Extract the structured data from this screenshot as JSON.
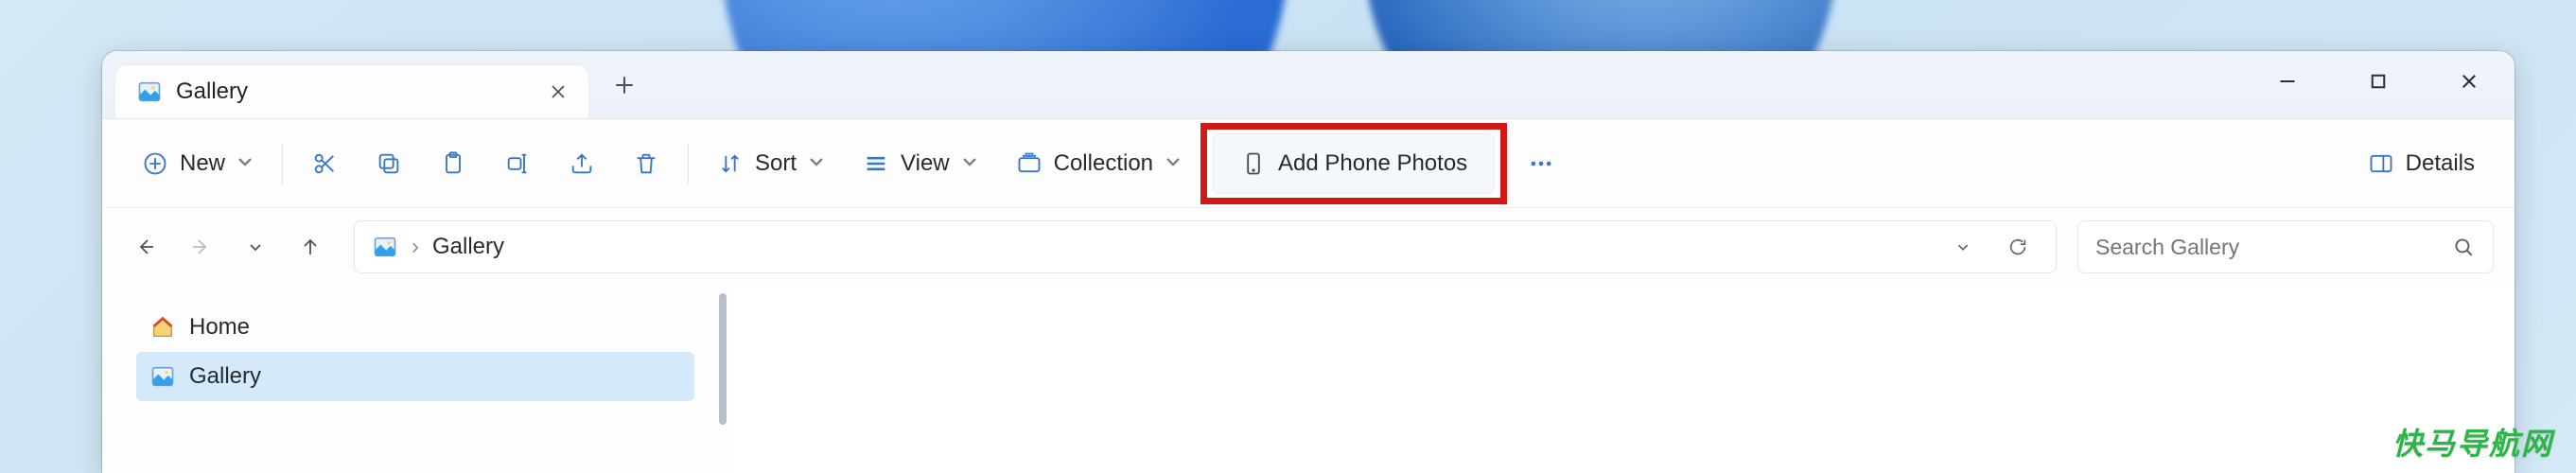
{
  "tab": {
    "title": "Gallery"
  },
  "toolbar": {
    "new_label": "New",
    "sort_label": "Sort",
    "view_label": "View",
    "collection_label": "Collection",
    "add_phone_label": "Add Phone Photos",
    "details_label": "Details"
  },
  "breadcrumb": {
    "label": "Gallery"
  },
  "search": {
    "placeholder": "Search Gallery"
  },
  "sidebar": {
    "items": [
      {
        "label": "Home"
      },
      {
        "label": "Gallery"
      }
    ]
  },
  "watermark": "快马导航网"
}
